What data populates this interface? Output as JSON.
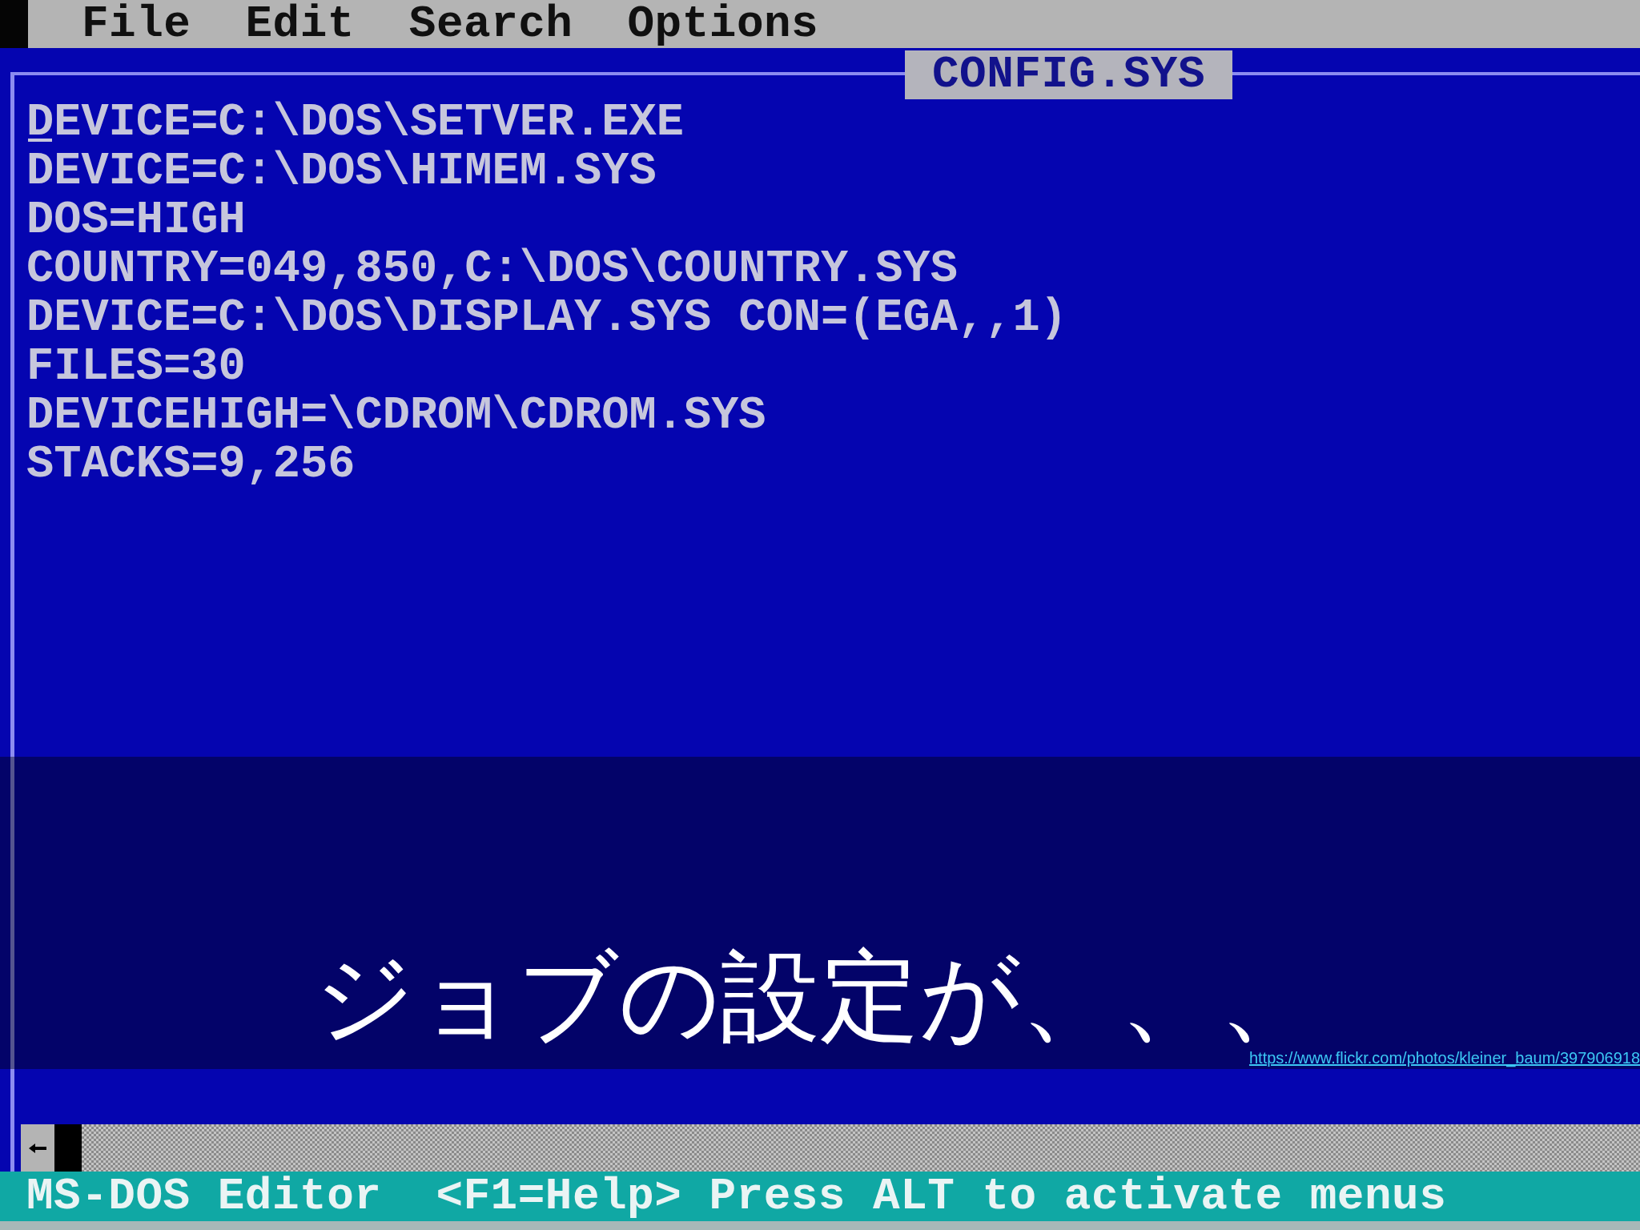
{
  "menu_bar": {
    "items": [
      {
        "label": "File"
      },
      {
        "label": "Edit"
      },
      {
        "label": "Search"
      },
      {
        "label": "Options"
      }
    ]
  },
  "editor": {
    "file_title": "CONFIG.SYS",
    "lines": [
      {
        "text": "DEVICE=C:\\DOS\\SETVER.EXE",
        "cursor": true
      },
      {
        "text": "DEVICE=C:\\DOS\\HIMEM.SYS",
        "cursor": false
      },
      {
        "text": "DOS=HIGH",
        "cursor": false
      },
      {
        "text": "COUNTRY=049,850,C:\\DOS\\COUNTRY.SYS",
        "cursor": false
      },
      {
        "text": "DEVICE=C:\\DOS\\DISPLAY.SYS CON=(EGA,,1)",
        "cursor": false
      },
      {
        "text": "FILES=30",
        "cursor": false
      },
      {
        "text": "DEVICEHIGH=\\CDROM\\CDROM.SYS",
        "cursor": false
      },
      {
        "text": "STACKS=9,256",
        "cursor": false
      }
    ]
  },
  "caption": {
    "text": "ジョブの設定が、、、",
    "link": "https://www.flickr.com/photos/kleiner_baum/397906918"
  },
  "status_bar": {
    "app_name": "MS-DOS Editor",
    "hint": "<F1=Help> Press ALT to activate menus"
  }
}
